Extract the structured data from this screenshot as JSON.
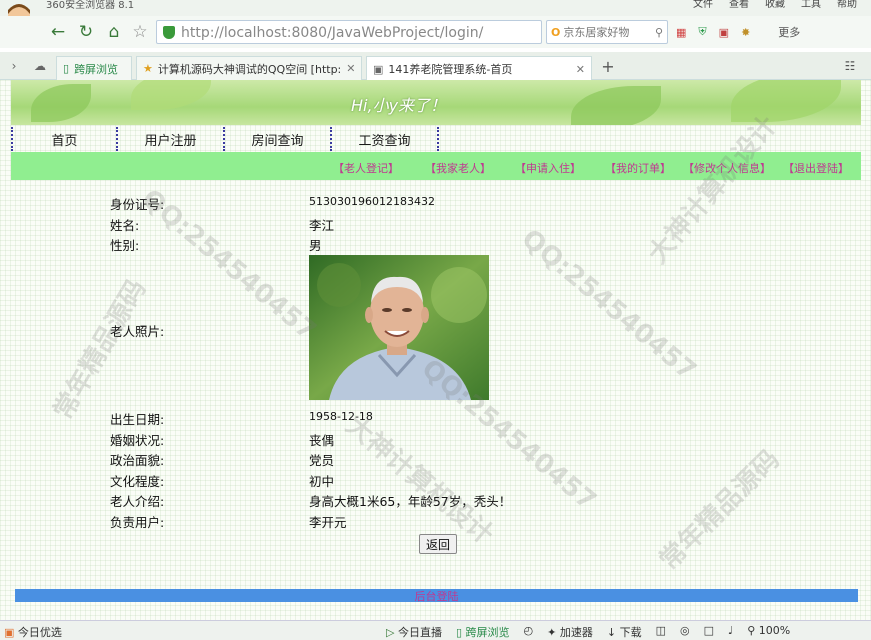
{
  "browser": {
    "title": "360安全浏览器 8.1",
    "menus": [
      "文件",
      "查看",
      "收藏",
      "工具",
      "帮助"
    ],
    "address": "http://localhost:8080/JavaWebProject/login/",
    "search_placeholder": "京东居家好物",
    "more_label": "更多",
    "tabs": [
      {
        "label": "跨屏浏览"
      },
      {
        "label": "计算机源码大神调试的QQ空间 [http:"
      },
      {
        "label": "141养老院管理系统-首页"
      }
    ],
    "new_tab": "+"
  },
  "banner": {
    "text": "Hi,小y来了！"
  },
  "main_nav": [
    "首页",
    "用户注册",
    "房间查询",
    "工资查询"
  ],
  "sub_nav": [
    "【老人登记】",
    "【我家老人】",
    "【申请入住】",
    "【我的订单】",
    "【修改个人信息】",
    "【退出登陆】"
  ],
  "elder": {
    "fields": [
      {
        "label": "身份证号:",
        "value": "513030196012183432"
      },
      {
        "label": "姓名:",
        "value": "李江"
      },
      {
        "label": "性别:",
        "value": "男"
      },
      {
        "label": "老人照片:",
        "value": ""
      },
      {
        "label": "出生日期:",
        "value": "1958-12-18"
      },
      {
        "label": "婚姻状况:",
        "value": "丧偶"
      },
      {
        "label": "政治面貌:",
        "value": "党员"
      },
      {
        "label": "文化程度:",
        "value": "初中"
      },
      {
        "label": "老人介绍:",
        "value": "身高大概1米65，年龄57岁，秃头！"
      },
      {
        "label": "负责用户:",
        "value": "李开元"
      }
    ]
  },
  "back_button": "返回",
  "footer_link": "后台登陆",
  "status": {
    "left": "今日优选",
    "items": [
      "今日直播",
      "跨屏浏览",
      "加速器",
      "下载"
    ],
    "zoom": "100%"
  },
  "watermarks": [
    "常年精品源码",
    "QQ:254540457",
    "大神计算机设计"
  ],
  "colors": {
    "subnav_bg": "#90ee90",
    "link": "#c03890",
    "footer_bg": "#4a90e2"
  }
}
